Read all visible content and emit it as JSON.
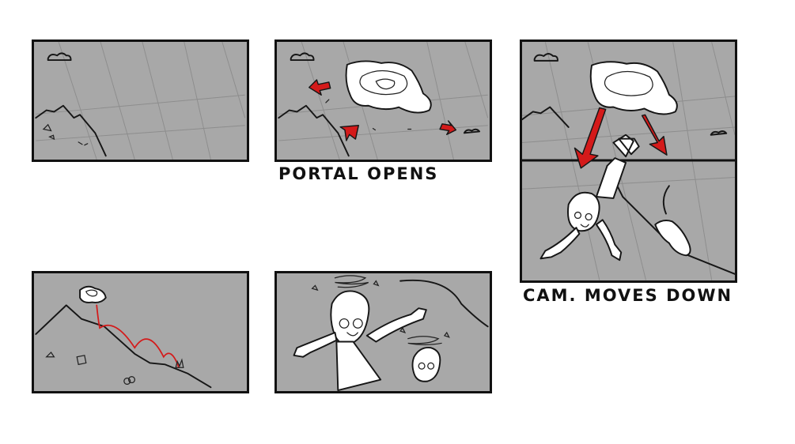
{
  "captions": {
    "portal": "PORTAL OPENS",
    "camera": "CAM. MOVES DOWN"
  },
  "colors": {
    "panel_fill": "#a8a8a8",
    "ink": "#111111",
    "accent_red": "#d41a1a"
  }
}
